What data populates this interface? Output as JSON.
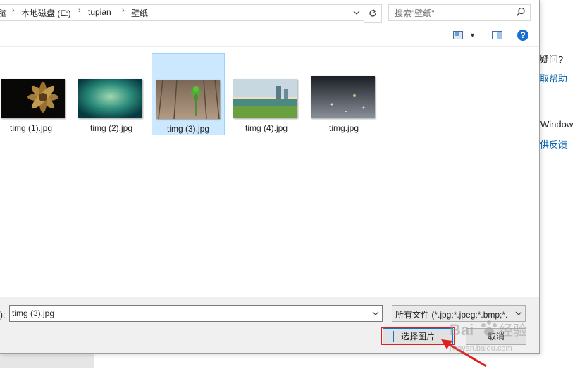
{
  "background_page": {
    "heading_1": "疑问?",
    "link_1": "取帮助",
    "heading_2": "Window",
    "link_2": "供反馈"
  },
  "address_bar": {
    "partial_crumb": "脑",
    "crumbs": [
      "本地磁盘 (E:)",
      "tupian",
      "壁纸"
    ],
    "separator": "›"
  },
  "search": {
    "placeholder": "搜索\"壁纸\""
  },
  "toolbar": {
    "help_label": "?"
  },
  "files": [
    {
      "name": "timg (1).jpg",
      "selected": false
    },
    {
      "name": "timg (2).jpg",
      "selected": false
    },
    {
      "name": "timg (3).jpg",
      "selected": true
    },
    {
      "name": "timg (4).jpg",
      "selected": false
    },
    {
      "name": "timg.jpg",
      "selected": false
    }
  ],
  "bottom": {
    "filename_label": "):",
    "filename_value": "timg (3).jpg",
    "filetype_value": "所有文件 (*.jpg;*.jpeg;*.bmp;*.",
    "open_button": "选择图片",
    "cancel_button": "取消"
  },
  "colors": {
    "selection_bg": "#cce8ff",
    "link": "#0063b1",
    "annotation_red": "#e02020",
    "accent_blue": "#0078d7"
  },
  "watermark": {
    "brand": "Bai",
    "brand_suffix": "经验",
    "url": "jingyan.baidu.com"
  }
}
